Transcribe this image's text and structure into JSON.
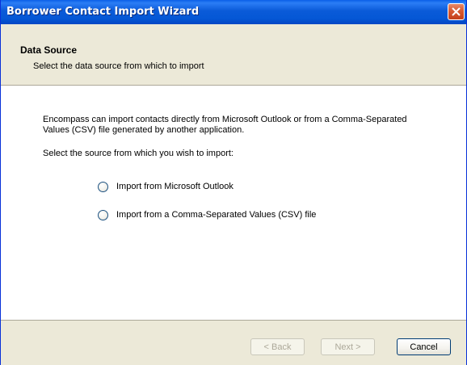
{
  "window": {
    "title": "Borrower Contact Import Wizard"
  },
  "header": {
    "title": "Data Source",
    "subtitle": "Select the data source from which to import"
  },
  "content": {
    "description": "Encompass can import contacts directly from Microsoft Outlook or from a Comma-Separated Values (CSV) file generated by another application.",
    "prompt": "Select the source from which you wish to import:",
    "options": [
      {
        "label": "Import from Microsoft Outlook",
        "selected": false
      },
      {
        "label": "Import from a Comma-Separated Values (CSV) file",
        "selected": false
      }
    ]
  },
  "footer": {
    "back_label": "< Back",
    "next_label": "Next >",
    "cancel_label": "Cancel",
    "back_enabled": false,
    "next_enabled": false
  },
  "colors": {
    "titlebar": "#0a5ad8",
    "close": "#d75a32",
    "dialog_bg": "#ece9d8"
  },
  "icons": {
    "close": "close-icon"
  }
}
